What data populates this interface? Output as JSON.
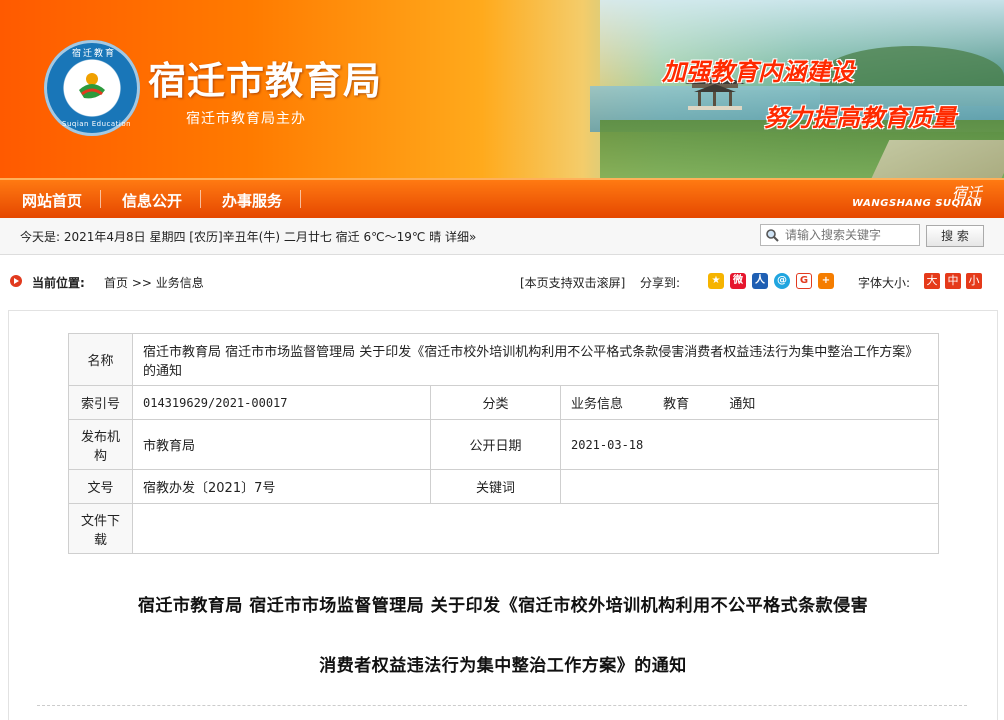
{
  "header": {
    "site_title": "宿迁市教育局",
    "subtitle": "宿迁市教育局主办",
    "slogan_1": "加强教育内涵建设",
    "slogan_2": "努力提高教育质量",
    "logo_text_top": "宿迁教育",
    "logo_text_bottom": "Suqian Education"
  },
  "nav": {
    "items": [
      "网站首页",
      "信息公开",
      "办事服务"
    ],
    "brand_en": "WANGSHANG SUQIAN",
    "brand_cn": "宿迁"
  },
  "infobar": {
    "date_text": "今天是:   2021年4月8日  星期四  [农历]辛丑年(牛) 二月廿七     宿迁 6℃～19℃ 晴 详细»",
    "search_placeholder": "请输入搜索关键字",
    "search_button": "搜 索"
  },
  "breadcrumb": {
    "label": "当前位置:",
    "path": "首页 >> 业务信息",
    "dblclick_tip": "[本页支持双击滚屏]",
    "share_label": "分享到:",
    "share_icons": [
      "qzone-icon",
      "weibo-icon",
      "renren-icon",
      "tencent-weibo-icon",
      "douban-icon",
      "more-share-icon"
    ],
    "font_size_label": "字体大小:",
    "font_sizes": [
      "大",
      "中",
      "小"
    ]
  },
  "meta_table": {
    "name_label": "名称",
    "name_value": "宿迁市教育局 宿迁市市场监督管理局 关于印发《宿迁市校外培训机构利用不公平格式条款侵害消费者权益违法行为集中整治工作方案》的通知",
    "index_label": "索引号",
    "index_value": "014319629/2021-00017",
    "category_label": "分类",
    "category_values": [
      "业务信息",
      "教育",
      "通知"
    ],
    "publisher_label": "发布机构",
    "publisher_value": "市教育局",
    "date_label": "公开日期",
    "date_value": "2021-03-18",
    "docno_label": "文号",
    "docno_value": "宿教办发〔2021〕7号",
    "keyword_label": "关键词",
    "keyword_value": "",
    "download_label": "文件下载",
    "download_value": ""
  },
  "document": {
    "title_line1": "宿迁市教育局 宿迁市市场监督管理局 关于印发《宿迁市校外培训机构利用不公平格式条款侵害",
    "title_line2": "消费者权益违法行为集中整治工作方案》的通知"
  }
}
